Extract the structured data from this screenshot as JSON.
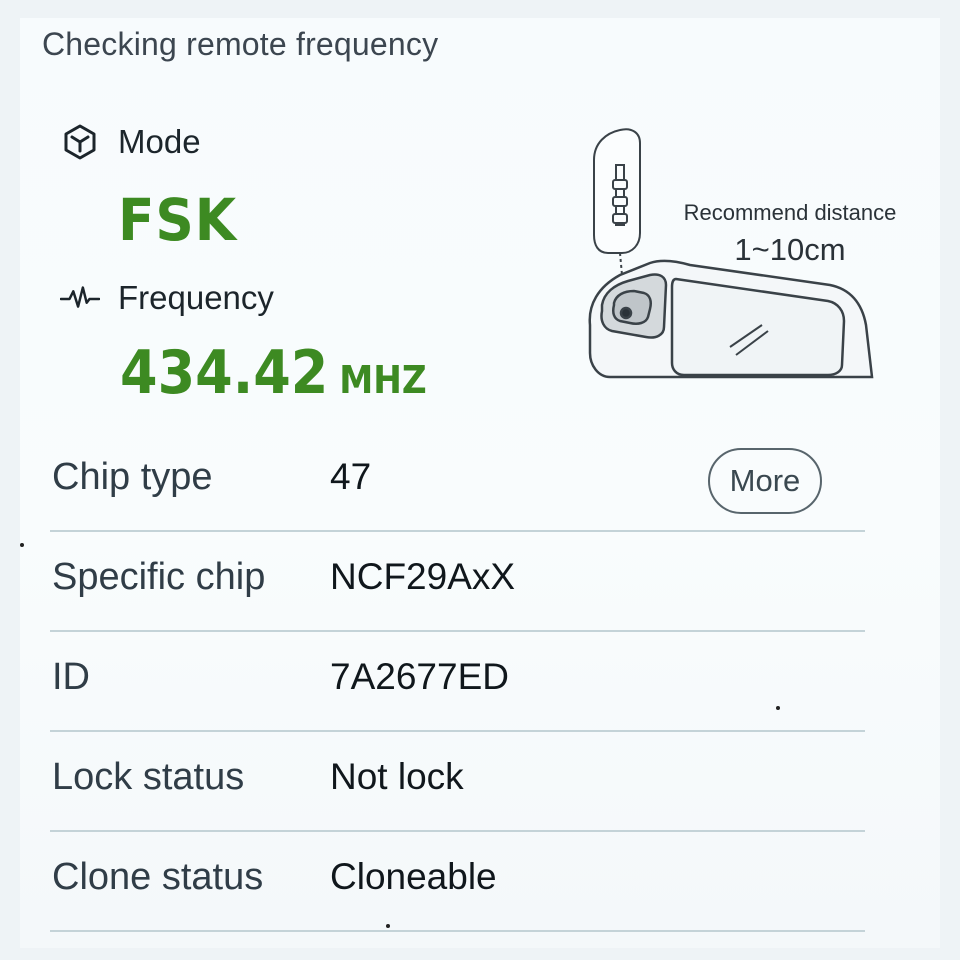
{
  "header": {
    "title": "Checking remote frequency"
  },
  "mode": {
    "label": "Mode",
    "value": "FSK",
    "icon": "cube-icon"
  },
  "frequency": {
    "label": "Frequency",
    "value": "434.42",
    "unit": "MHZ",
    "icon": "waveform-icon"
  },
  "distance_hint": {
    "label": "Recommend distance",
    "value": "1~10cm"
  },
  "info": {
    "rows": [
      {
        "key": "Chip type",
        "value": "47"
      },
      {
        "key": "Specific chip",
        "value": "NCF29AxX"
      },
      {
        "key": "ID",
        "value": "7A2677ED"
      },
      {
        "key": "Lock status",
        "value": "Not lock"
      },
      {
        "key": "Clone status",
        "value": "Cloneable"
      }
    ],
    "more_button": "More"
  },
  "colors": {
    "accent_green": "#3d8a22",
    "divider": "#c4d3d8",
    "background": "#f7fbfd"
  }
}
